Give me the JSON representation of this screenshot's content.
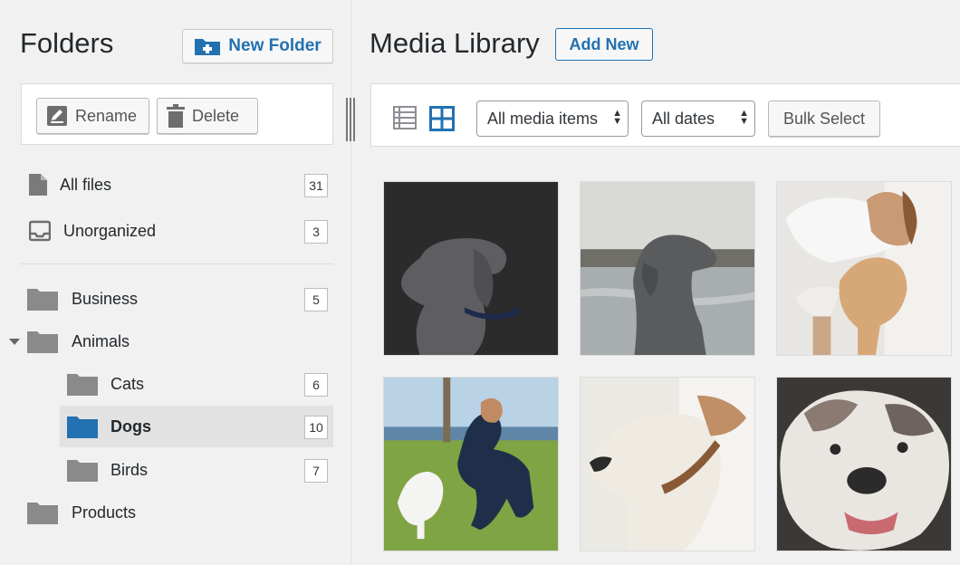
{
  "sidebar": {
    "title": "Folders",
    "new_folder_label": "New Folder",
    "rename_label": "Rename",
    "delete_label": "Delete",
    "items": [
      {
        "label": "All files",
        "count": "31",
        "icon": "file-icon"
      },
      {
        "label": "Unorganized",
        "count": "3",
        "icon": "inbox-icon"
      },
      {
        "label": "Business",
        "count": "5",
        "icon": "folder-icon"
      },
      {
        "label": "Animals",
        "count": "",
        "icon": "folder-icon"
      },
      {
        "label": "Cats",
        "count": "6",
        "icon": "folder-icon"
      },
      {
        "label": "Dogs",
        "count": "10",
        "icon": "folder-icon",
        "selected": true
      },
      {
        "label": "Birds",
        "count": "7",
        "icon": "folder-icon"
      },
      {
        "label": "Products",
        "count": "",
        "icon": "folder-icon"
      }
    ]
  },
  "main": {
    "title": "Media Library",
    "add_new_label": "Add New",
    "filter_type": "All media items",
    "filter_date": "All dates",
    "bulk_select_label": "Bulk Select",
    "tiles": [
      {
        "subject": "grey weimaraner on dark background"
      },
      {
        "subject": "weimaraner by the lake"
      },
      {
        "subject": "woman with small terrier dog"
      },
      {
        "subject": "man playing with white puppy on grass"
      },
      {
        "subject": "white dog with brown collar"
      },
      {
        "subject": "bulldog close-up"
      }
    ]
  },
  "colors": {
    "accent": "#2271b1",
    "selected_folder": "#2271b1",
    "folder_grey": "#8c8f94",
    "background": "#f1f1f1"
  }
}
